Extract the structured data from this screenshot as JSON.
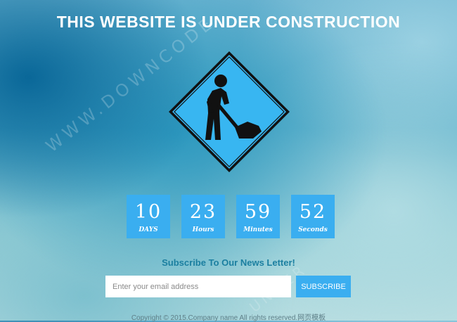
{
  "header": {
    "title": "THIS WEBSITE IS UNDER CONSTRUCTION"
  },
  "hero": {
    "icon": "construction-worker-sign-icon",
    "sign_color": "#38b6f1",
    "border_color": "#111111"
  },
  "watermark": {
    "text": "WWW.DOWNCODE",
    "text_2": "UNDER"
  },
  "countdown": {
    "tile_color": "#3aaef0",
    "days": {
      "value": "10",
      "label": "DAYS"
    },
    "hours": {
      "value": "23",
      "label": "Hours"
    },
    "minutes": {
      "value": "59",
      "label": "Minutes"
    },
    "seconds": {
      "value": "52",
      "label": "Seconds"
    }
  },
  "subscribe": {
    "heading": "Subscribe To Our News Letter!",
    "email_placeholder": "Enter your email address",
    "email_value": "",
    "button_label": "SUBSCRIBE"
  },
  "footer": {
    "copyright": "Copyright © 2015.Company name All rights reserved.网页模板"
  }
}
